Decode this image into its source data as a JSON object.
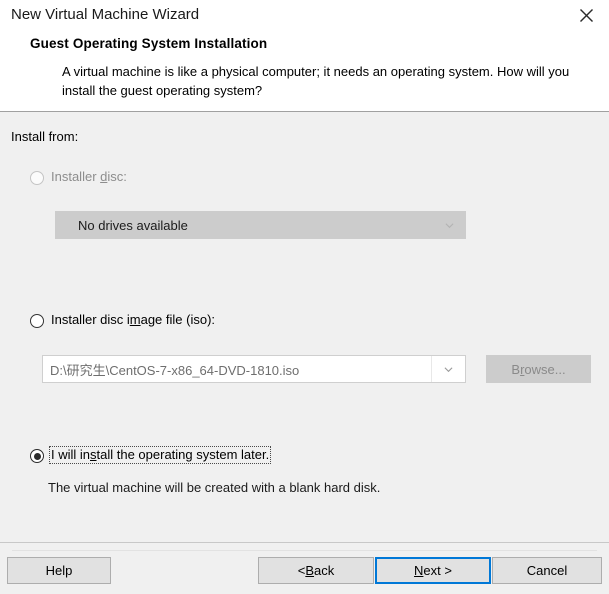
{
  "window": {
    "title": "New Virtual Machine Wizard",
    "close_icon": "close-x-icon"
  },
  "header": {
    "heading": "Guest Operating System Installation",
    "description": "A virtual machine is like a physical computer; it needs an operating system. How will you install the guest operating system?"
  },
  "main": {
    "install_from_label": "Install from:",
    "options": [
      {
        "id": "installer-disc",
        "label_before": "Installer ",
        "label_accel": "d",
        "label_after": "isc:",
        "selected": false,
        "enabled": false
      },
      {
        "id": "installer-iso",
        "label_before": "Installer disc i",
        "label_accel": "m",
        "label_after": "age file (iso):",
        "selected": false,
        "enabled": true
      },
      {
        "id": "install-later",
        "label_before": "I will in",
        "label_accel": "s",
        "label_after": "tall the operating system later.",
        "selected": true,
        "enabled": true
      }
    ],
    "drive_combo": {
      "value": "No drives available",
      "enabled": false,
      "arrow_icon": "chevron-down-icon"
    },
    "iso_combo": {
      "value": "D:\\研究生\\CentOS-7-x86_64-DVD-1810.iso",
      "enabled": false,
      "arrow_icon": "chevron-down-icon"
    },
    "browse_button": {
      "label_before": "B",
      "label_accel": "r",
      "label_after": "owse...",
      "enabled": false
    },
    "later_description": "The virtual machine will be created with a blank hard disk."
  },
  "footer": {
    "help": {
      "label": "Help"
    },
    "back": {
      "label_before": "< ",
      "label_accel": "B",
      "label_after": "ack"
    },
    "next": {
      "label_before": "",
      "label_accel": "N",
      "label_after": "ext >",
      "focused": true
    },
    "cancel": {
      "label": "Cancel"
    }
  },
  "colors": {
    "accent_focus": "#0078d7",
    "header_bg": "#ffffff",
    "body_bg": "#f0f0f0",
    "disabled_bg": "#cccccc",
    "disabled_text": "#8a8a8a"
  }
}
